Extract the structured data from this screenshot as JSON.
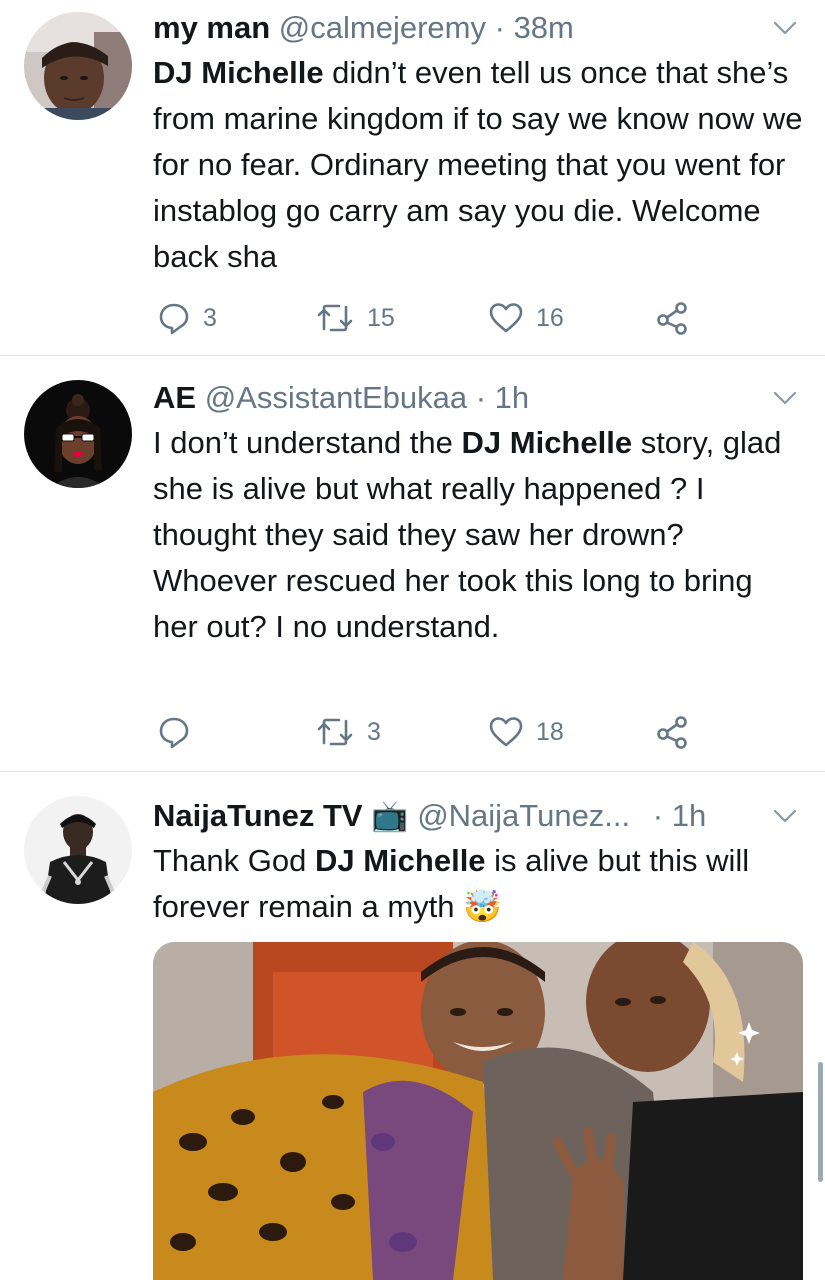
{
  "tweets": [
    {
      "display_name": "my man",
      "handle": "@calmejeremy",
      "separator": "·",
      "time": "38m",
      "text_parts": [
        {
          "bold": true,
          "text": "DJ Michelle"
        },
        {
          "bold": false,
          "text": " didn’t even tell us once that she’s from marine kingdom if to say we know now we for no fear. Ordinary meeting that you went for instablog go carry am say you die. Welcome back sha"
        }
      ],
      "reply_count": "3",
      "retweet_count": "15",
      "like_count": "16"
    },
    {
      "display_name": "AE",
      "handle": "@AssistantEbukaa",
      "separator": "·",
      "time": "1h",
      "text_parts": [
        {
          "bold": false,
          "text": "I don’t understand the "
        },
        {
          "bold": true,
          "text": "DJ Michelle"
        },
        {
          "bold": false,
          "text": " story, glad she is alive but what really happened ? I thought they said they saw her drown? Whoever rescued her took this long to bring her out? I no understand."
        }
      ],
      "reply_count": "",
      "retweet_count": "3",
      "like_count": "18"
    },
    {
      "display_name": "NaijaTunez TV",
      "name_emoji": "📺",
      "handle": "@NaijaTunez...",
      "separator": "·",
      "time": "1h",
      "text_parts": [
        {
          "bold": false,
          "text": "Thank God "
        },
        {
          "bold": true,
          "text": "DJ Michelle"
        },
        {
          "bold": false,
          "text": " is alive but this will forever remain a myth "
        },
        {
          "bold": false,
          "text": "🤯"
        }
      ]
    }
  ],
  "icons": {
    "reply": "reply-icon",
    "retweet": "retweet-icon",
    "like": "heart-icon",
    "share": "share-icon",
    "caret": "chevron-down-icon"
  },
  "colors": {
    "text": "#14171a",
    "secondary": "#657786",
    "divider": "#e1e8ed"
  }
}
